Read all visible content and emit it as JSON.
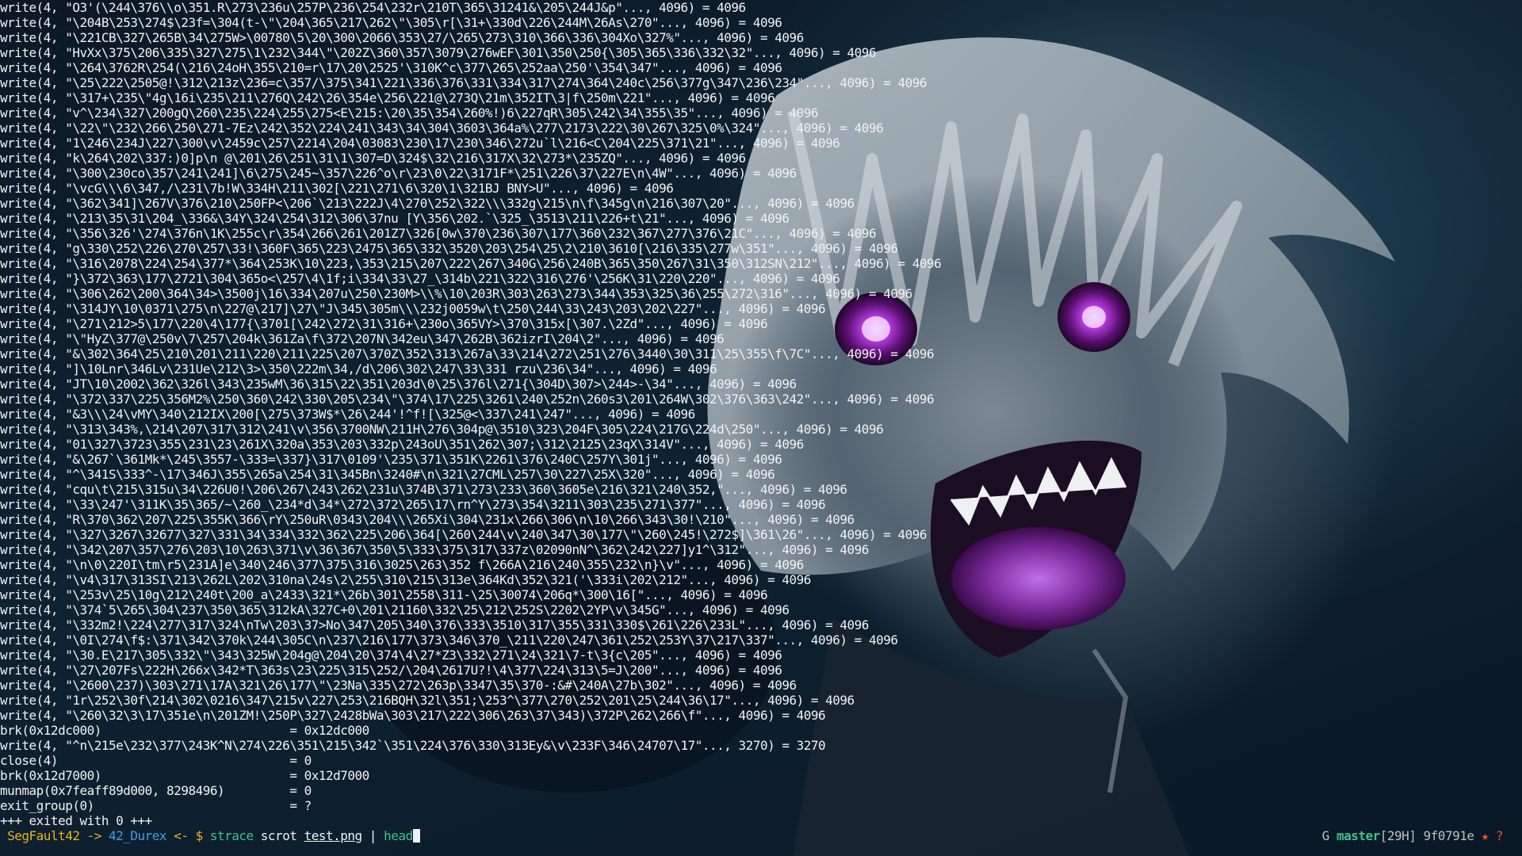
{
  "terminal": {
    "output_lines": [
      "write(4, \"O3'(\\244\\376\\\\o\\351.R\\273\\236u\\257P\\236\\254\\232r\\210T\\365\\31241&\\205\\244J&p\"..., 4096) = 4096",
      "write(4, \"\\204B\\253\\274$\\23f=\\304(t-\\\"\\204\\365\\217\\262\\\"\\305\\r[\\31+\\330d\\226\\244M\\26As\\270\"..., 4096) = 4096",
      "write(4, \"\\221CB\\327\\265B\\34\\275W>\\00780\\5\\20\\300\\2066\\353\\27/\\265\\273\\310\\366\\336\\304Xo\\327%\"..., 4096) = 4096",
      "write(4, \"HvXx\\375\\206\\335\\327\\275\\1\\232\\344\\\"\\202Z\\360\\357\\3079\\276wEF\\301\\350\\250{\\305\\365\\336\\332\\32\"..., 4096) = 4096",
      "write(4, \"\\264\\3762R\\254(\\216\\24oH\\355\\210=r\\17\\20\\2525'\\310K^c\\377\\265\\252aa\\250'\\354\\347\"..., 4096) = 4096",
      "write(4, \"\\25\\222\\2505@!\\312\\213z\\236=c\\357/\\375\\341\\221\\336\\376\\331\\334\\317\\274\\364\\240c\\256\\377g\\347\\236\\234\"..., 4096) = 4096",
      "write(4, \"\\317+\\235\\\"4g\\16i\\235\\211\\276Q\\242\\26\\354e\\256\\221@\\273Q\\21m\\352IT\\3|f\\250m\\221\"..., 4096) = 4096",
      "write(4, \"v^\\234\\327\\200gQ\\260\\235\\224\\255\\275<E\\215:\\20\\35\\354\\260%!)6\\227qR\\305\\242\\34\\355\\35\"..., 4096) = 4096",
      "write(4, \"\\22\\\"\\232\\266\\250\\271-7Ez\\242\\352\\224\\241\\343\\34\\304\\3603\\364a%\\277\\2173\\222\\30\\267\\325\\0%\\324\"..., 4096) = 4096",
      "write(4, \"1\\246\\234J\\227\\300\\v\\2459c\\257\\2214\\204\\03083\\230\\17\\230\\346\\272u`l\\216<C\\204\\225\\371\\21\"..., 4096) = 4096",
      "write(4, \"k\\264\\202\\337:)0]p\\n @\\201\\26\\251\\31\\1\\307=D\\324$\\32\\216\\317X\\32\\273*\\235ZQ\"..., 4096) = 4096",
      "write(4, \"\\300\\230co\\357\\241\\241]\\6\\275\\245~\\357\\226^o\\r\\23\\0\\22\\3171F*\\251\\226\\37\\227E\\n\\4W\"..., 4096) = 4096",
      "write(4, \"\\vcG\\\\\\6\\347,/\\231\\7b!W\\334H\\211\\302[\\221\\271\\6\\320\\1\\321BJ BNY>U\"..., 4096) = 4096",
      "write(4, \"\\362\\341]\\267V\\376\\210\\250FP<\\206`\\213\\222J\\4\\270\\252\\322\\\\\\332g\\215\\n\\f\\345g\\n\\216\\307\\20\"..., 4096) = 4096",
      "write(4, \"\\213\\35\\31\\204_\\336&\\34Y\\324\\254\\312\\306\\37nu [Y\\356\\202.`\\325_\\3513\\211\\226+t\\21\"..., 4096) = 4096",
      "write(4, \"\\356\\326'\\274\\376n\\1K\\255c\\r\\354\\266\\261\\201Z7\\326[0w\\370\\236\\307\\177\\360\\232\\367\\277\\376\\21C\"..., 4096) = 4096",
      "write(4, \"g\\330\\252\\226\\270\\257\\33!\\360F\\365\\223\\2475\\365\\332\\3520\\203\\254\\25\\2\\210\\3610[\\216\\335\\277w\\351\"..., 4096) = 4096",
      "write(4, \"\\316\\2078\\224\\254\\377*\\364\\253K\\10\\223,\\353\\215\\207\\222\\267\\340G\\256\\240B\\365\\350\\267\\31\\350\\312SN\\212\"..., 4096) = 4096",
      "write(4, \"}\\372\\363\\177\\2721\\304\\365o<\\257\\4\\1f;i\\334\\33\\27_\\314b\\221\\322\\316\\276'\\256K\\31\\220\\220\"..., 4096) = 4096",
      "write(4, \"\\306\\262\\200\\364\\34>\\3500j\\16\\334\\207u\\250\\230M>\\\\%\\10\\203R\\303\\263\\273\\344\\353\\325\\36\\255\\272\\316\"..., 4096) = 4096",
      "write(4, \"\\314JY\\10\\0371\\275\\n\\227@\\217]\\27\\\"J\\345\\305m\\\\\\232j0059w\\t\\250\\244\\33\\243\\203\\202\\227\"..., 4096) = 4096",
      "write(4, \"\\271\\212>5\\177\\220\\4\\177{\\3701[\\242\\272\\31\\316+\\230o\\365VY>\\370\\315x[\\307.\\2Zd\"..., 4096) = 4096",
      "write(4, \"\\\"HyZ\\377@\\250v\\7\\257\\204k\\361Za\\f\\372\\207N\\342eu\\347\\262B\\362izrI\\204\\2\"..., 4096) = 4096",
      "write(4, \"&\\302\\364\\25\\210\\201\\211\\220\\211\\225\\207\\370Z\\352\\313\\267a\\33\\214\\272\\251\\276\\3440\\30\\311\\25\\355\\f\\7C\"..., 4096) = 4096",
      "write(4, \"]\\10Lnr\\346Lv\\231Ue\\212\\3>\\350\\222m\\34,/d\\206\\302\\247\\33\\331 rzu\\236\\34\"..., 4096) = 4096",
      "write(4, \"JT\\10\\2002\\362\\326l\\343\\235wM\\36\\315\\22\\351\\203d\\0\\25\\376l\\271{\\304D\\307>\\244>-\\34\"..., 4096) = 4096",
      "write(4, \"\\372\\337\\225\\356M2%\\250\\360\\242\\330\\205\\234\\\"\\374\\17\\225\\3261\\240\\252n\\260s3\\201\\264W\\302\\376\\363\\242\"..., 4096) = 4096",
      "write(4, \"&3\\\\\\24\\vMY\\340\\212IX\\200[\\275\\373W$*\\26\\244'!^f![\\325@<\\337\\241\\247\"..., 4096) = 4096",
      "write(4, \"\\313\\343%,\\214\\207\\317\\312\\241\\v\\356\\3700NW\\211H\\276\\304p@\\3510\\323\\204F\\305\\224\\217G\\224d\\250\"..., 4096) = 4096",
      "write(4, \"01\\327\\3723\\355\\231\\23\\261X\\320a\\353\\203\\332p\\243oU\\351\\262\\307;\\312\\2125\\23qX\\314V\"..., 4096) = 4096",
      "write(4, \"&\\267`\\361Mk*\\245\\3557-\\333=\\337}\\317\\0109'\\235\\371\\351K\\2261\\376\\240C\\257Y\\301j\"..., 4096) = 4096",
      "write(4, \"^\\341S\\333^-\\17\\346J\\355\\265a\\254\\31\\345Bn\\3240#\\n\\321\\27CML\\257\\30\\227\\25X\\320\"..., 4096) = 4096",
      "write(4, \"cqu\\t\\215\\315u\\34\\226U0!\\206\\267\\243\\262\\231u\\374B\\371\\273\\233\\360\\3605e\\216\\321\\240\\352,\"..., 4096) = 4096",
      "write(4, \"\\33\\247'\\311K\\35\\365/~\\260_\\234*d\\34*\\272\\372\\265\\17\\rn^Y\\273\\354\\3211\\303\\235\\271\\377\"..., 4096) = 4096",
      "write(4, \"R\\370\\362\\207\\225\\355K\\366\\rY\\250uR\\0343\\204\\\\\\265Xi\\304\\231x\\266\\306\\n\\10\\266\\343\\30!\\210\"..., 4096) = 4096",
      "write(4, \"\\327\\3267\\32677\\327\\331\\34\\334\\332\\362\\225\\206\\364[\\260\\244\\v\\240\\347\\30\\177\\\"\\260\\245!\\272$]\\361\\26\"..., 4096) = 4096",
      "write(4, \"\\342\\207\\357\\276\\203\\10\\263\\371\\v\\36\\367\\350\\5\\333\\375\\317\\337z\\02090nN^\\362\\242\\227]y1^\\312\"..., 4096) = 4096",
      "write(4, \"\\n\\0\\220I\\tm\\r5\\231A]e\\340\\246\\377\\375\\316\\3025\\263\\352 f\\266A\\216\\240\\355\\232\\n}\\v\"..., 4096) = 4096",
      "write(4, \"\\v4\\317\\313SI\\213\\262L\\202\\310na\\24s\\2\\255\\310\\215\\313e\\364Kd\\352\\321('\\333i\\202\\212\"..., 4096) = 4096",
      "write(4, \"\\253v\\25\\10g\\212\\240t\\200_a\\2433\\321*\\26b\\301\\2558\\311-\\25\\30074\\206q*\\300\\16[\"..., 4096) = 4096",
      "write(4, \"\\374`5\\265\\304\\237\\350\\365\\312kA\\327C+0\\201\\21160\\332\\25\\212\\252S\\2202\\2YP\\v\\345G\"..., 4096) = 4096",
      "write(4, \"\\332m2!\\224\\277\\317\\324\\nTw\\203\\37>No\\347\\205\\340\\376\\333\\3510\\317\\355\\331\\330$\\261\\226\\233L\"..., 4096) = 4096",
      "write(4, \"\\0I\\274\\f$:\\371\\342\\370k\\244\\305C\\n\\237\\216\\177\\373\\346\\370_\\211\\220\\247\\361\\252\\253Y\\37\\217\\337\"..., 4096) = 4096",
      "write(4, \"\\30.E\\217\\305\\332\\\"\\343\\325W\\204g@\\204\\20\\374\\4\\27*Z3\\332\\271\\24\\321\\7-t\\3{c\\205\"..., 4096) = 4096",
      "write(4, \"\\27\\207Fs\\222H\\266x\\342*T\\363s\\23\\225\\315\\252/\\204\\2617U?!\\4\\377\\224\\313\\5=J\\200\"..., 4096) = 4096",
      "write(4, \"\\2600\\237)\\303\\271\\17A\\321\\26\\177\\\"\\23Na\\335\\272\\263p\\3347\\35\\370-:&#\\240A\\27b\\302\"..., 4096) = 4096",
      "write(4, \"1r\\252\\30f\\214\\302\\0216\\347\\215v\\227\\253\\216BQH\\32l\\351;\\253^\\377\\270\\252\\201\\25\\244\\36\\17\"..., 4096) = 4096",
      "write(4, \"\\260\\32\\3\\17\\351e\\n\\201ZM!\\250P\\327\\2428bWa\\303\\217\\222\\306\\263\\37\\343)\\372P\\262\\266\\f\"..., 4096) = 4096",
      "brk(0x12dc000)                          = 0x12dc000",
      "write(4, \"^n\\215e\\232\\377\\243K^N\\274\\226\\351\\215\\342`\\351\\224\\376\\330\\313Ey&\\v\\233F\\346\\24707\\17\"..., 3270) = 3270",
      "close(4)                                = 0",
      "brk(0x12d7000)                          = 0x12d7000",
      "munmap(0x7feaff89d000, 8298496)         = 0",
      "exit_group(0)                           = ?",
      "+++ exited with 0 +++"
    ],
    "prompt": {
      "user": " SegFault42",
      "arrow_right": " -> ",
      "directory": "42_Durex",
      "arrow_left": " <- ",
      "dollar": "$ ",
      "command": "strace",
      "arg": " scrot ",
      "file": "test.png",
      "pipe": " | ",
      "command2": "head"
    },
    "git_status": {
      "label": "G ",
      "branch": "master",
      "time": "[29H]",
      "hash": " 9f0791e",
      "dirty_marker": " ★",
      "unknown_marker": " ?"
    }
  },
  "colors": {
    "text": "#f2f2f2",
    "prompt_accent": "#e6b422",
    "directory": "#3fa0e0",
    "command": "#3fc48e",
    "warning": "#e05a2a"
  },
  "icons": {
    "cursor": "block-cursor-icon"
  }
}
